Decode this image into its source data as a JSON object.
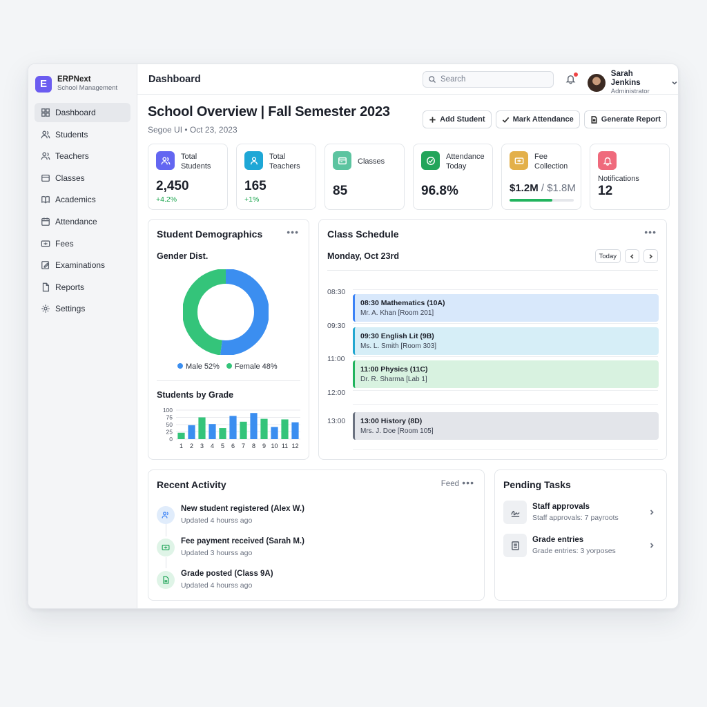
{
  "brand": {
    "name": "ERPNext",
    "subtitle": "School Management",
    "logo_letter": "E",
    "color": "#6b5cf0"
  },
  "sidebar": {
    "items": [
      {
        "label": "Dashboard",
        "icon": "grid-icon",
        "active": true
      },
      {
        "label": "Students",
        "icon": "users-icon"
      },
      {
        "label": "Teachers",
        "icon": "user-group-icon"
      },
      {
        "label": "Classes",
        "icon": "layers-icon"
      },
      {
        "label": "Academics",
        "icon": "book-icon"
      },
      {
        "label": "Attendance",
        "icon": "calendar-icon"
      },
      {
        "label": "Fees",
        "icon": "money-icon"
      },
      {
        "label": "Examinations",
        "icon": "edit-icon"
      },
      {
        "label": "Reports",
        "icon": "file-icon"
      },
      {
        "label": "Settings",
        "icon": "gear-icon"
      }
    ]
  },
  "topbar": {
    "title": "Dashboard",
    "search_placeholder": "Search",
    "user": {
      "name": "Sarah Jenkins",
      "role": "Administrator"
    },
    "notification_dot_color": "#ef4444"
  },
  "page": {
    "title": "School Overview | Fall Semester 2023",
    "subtitle": "Segoe UI • Oct 23, 2023",
    "actions": {
      "add_student": "Add Student",
      "mark_attendance": "Mark Attendance",
      "generate_report": "Generate Report"
    }
  },
  "stats": {
    "students": {
      "label": "Total Students",
      "value": "2,450",
      "delta": "+4.2%",
      "icon": "users-icon",
      "color": "#6366f1"
    },
    "teachers": {
      "label": "Total Teachers",
      "value": "165",
      "delta": "+1%",
      "icon": "user-icon",
      "color": "#1ea7d6"
    },
    "classes": {
      "label": "Classes",
      "value": "85",
      "icon": "classroom-icon",
      "color": "#5cc4a0"
    },
    "attendance": {
      "label": "Attendance Today",
      "value": "96.8%",
      "icon": "check-circle-icon",
      "color": "#22a55a"
    },
    "fees": {
      "label": "Fee Collection",
      "value": "$1.2M",
      "total": "/ $1.8M",
      "progress": 0.67,
      "icon": "cash-icon",
      "color": "#e3b04a"
    },
    "notifications": {
      "label": "Notifications",
      "value": "12",
      "icon": "bell-icon",
      "color": "#ef6a7c"
    }
  },
  "demographics": {
    "title": "Student Demographics",
    "gender_title": "Gender Dist.",
    "grade_title": "Students by Grade"
  },
  "schedule": {
    "title": "Class Schedule",
    "day": "Monday, Oct 23rd",
    "today_label": "Today",
    "times": [
      "08:30",
      "09:30",
      "11:00",
      "12:00",
      "13:00"
    ],
    "events": [
      {
        "title": "08:30 Mathematics (10A)",
        "sub": "Mr. A. Khan [Room 201]",
        "bg": "#d8e8fb",
        "accent": "#3b82f6"
      },
      {
        "title": "09:30 English Lit (9B)",
        "sub": "Ms. L. Smith [Room 303]",
        "bg": "#d6eef7",
        "accent": "#22a7d0"
      },
      {
        "title": "11:00 Physics (11C)",
        "sub": "Dr. R. Sharma [Lab 1]",
        "bg": "#d8f2e0",
        "accent": "#22b45e"
      },
      {
        "title": "13:00 History (8D)",
        "sub": "Mrs. J. Doe [Room 105]",
        "bg": "#e3e5ea",
        "accent": "#6b7280"
      }
    ]
  },
  "activity": {
    "title": "Recent Activity",
    "feed_label": "Feed",
    "items": [
      {
        "title": "New student registered (Alex W.)",
        "time": "Updated 4 hourss ago",
        "icon": "user-add-icon"
      },
      {
        "title": "Fee payment received (Sarah M.)",
        "time": "Updated 3 hourss ago",
        "icon": "cash-icon"
      },
      {
        "title": "Grade posted (Class 9A)",
        "time": "Updated 4 hourss ago",
        "icon": "document-icon"
      }
    ]
  },
  "tasks": {
    "title": "Pending Tasks",
    "items": [
      {
        "title": "Staff approvals",
        "sub": "Staff approvals: 7 payroots",
        "icon": "signature-icon"
      },
      {
        "title": "Grade entries",
        "sub": "Grade entries: 3 yorposes",
        "icon": "document-icon"
      }
    ]
  },
  "chart_data": [
    {
      "type": "pie",
      "title": "Gender Dist.",
      "categories": [
        "Male 52%",
        "Female 48%"
      ],
      "values": [
        52,
        48
      ],
      "colors": [
        "#3b8ef0",
        "#34c47a"
      ],
      "legend": "bottom"
    },
    {
      "type": "bar",
      "title": "Students by Grade",
      "categories": [
        "1",
        "2",
        "3",
        "4",
        "5",
        "6",
        "7",
        "8",
        "9",
        "10",
        "11",
        "12"
      ],
      "values": [
        22,
        48,
        75,
        52,
        38,
        80,
        60,
        90,
        70,
        42,
        68,
        58
      ],
      "colors": [
        "#3b8ef0",
        "#34c47a"
      ],
      "yticks": [
        "100",
        "75",
        "50",
        "25",
        "0"
      ],
      "ylim": [
        0,
        100
      ],
      "grid": true
    }
  ]
}
